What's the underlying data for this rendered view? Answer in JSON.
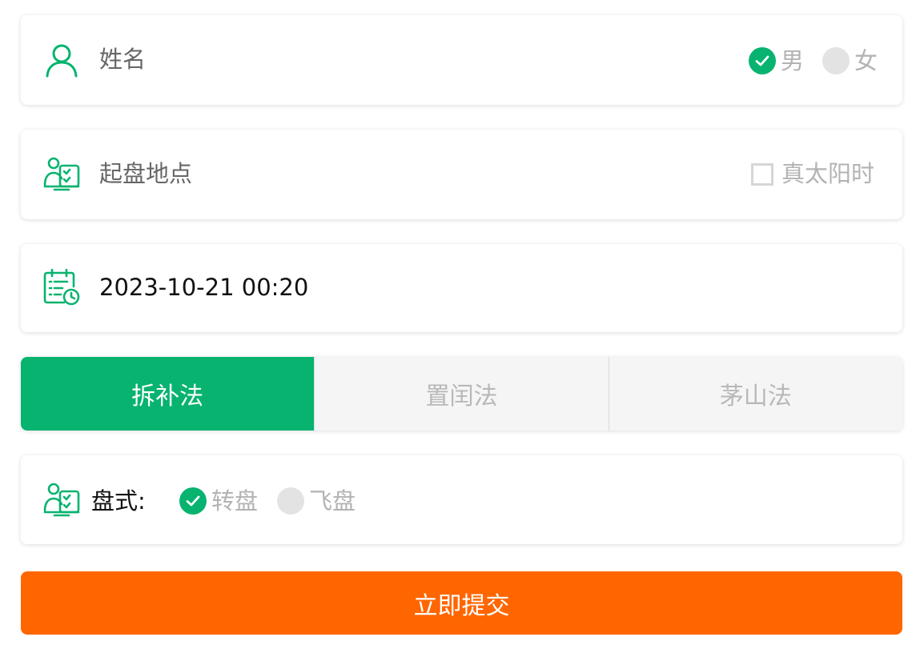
{
  "colors": {
    "accent_green": "#07b36f",
    "submit_orange": "#ff6600",
    "muted_text": "#b3b3b3"
  },
  "name_card": {
    "icon": "user-icon",
    "placeholder": "姓名",
    "gender": {
      "selected": "男",
      "options": [
        "男",
        "女"
      ]
    }
  },
  "location_card": {
    "icon": "profile-checklist-icon",
    "placeholder": "起盘地点",
    "true_solar_time_label": "真太阳时",
    "true_solar_time_checked": false
  },
  "datetime_card": {
    "icon": "calendar-clock-icon",
    "value": "2023-10-21 00:20"
  },
  "method_tabs": {
    "active": "拆补法",
    "items": [
      "拆补法",
      "置闰法",
      "茅山法"
    ]
  },
  "chart_style_card": {
    "icon": "profile-checklist-icon",
    "label": "盘式:",
    "selected": "转盘",
    "options": [
      "转盘",
      "飞盘"
    ]
  },
  "submit_label": "立即提交"
}
